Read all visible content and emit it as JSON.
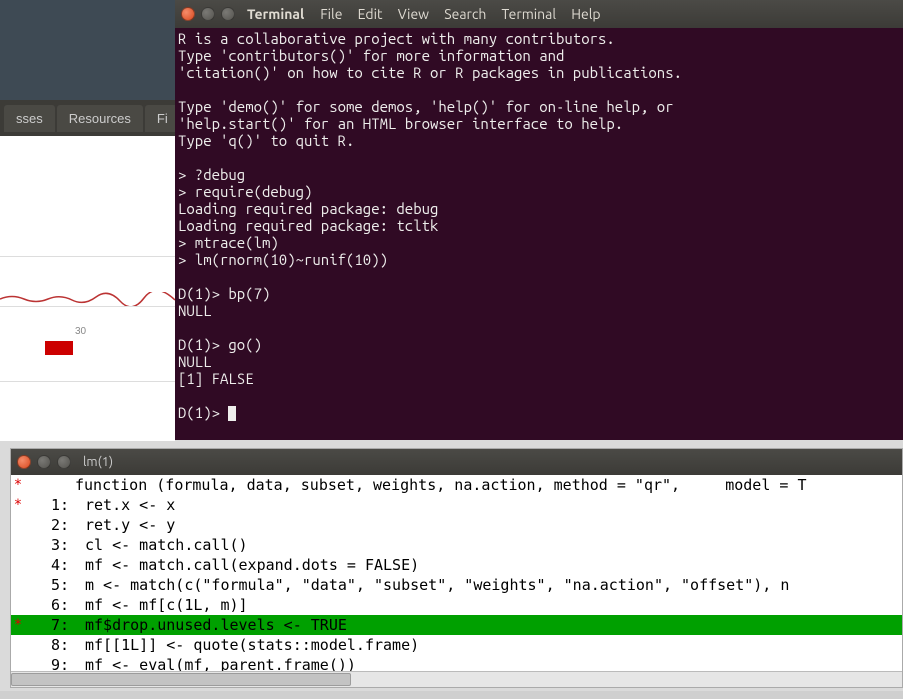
{
  "bg": {
    "tabs": [
      "sses",
      "Resources",
      "Fi"
    ],
    "axis_tick": "30"
  },
  "terminal": {
    "title": "Terminal",
    "menus": [
      "File",
      "Edit",
      "View",
      "Search",
      "Terminal",
      "Help"
    ],
    "lines": [
      "R is a collaborative project with many contributors.",
      "Type 'contributors()' for more information and",
      "'citation()' on how to cite R or R packages in publications.",
      "",
      "Type 'demo()' for some demos, 'help()' for on-line help, or",
      "'help.start()' for an HTML browser interface to help.",
      "Type 'q()' to quit R.",
      "",
      "> ?debug",
      "> require(debug)",
      "Loading required package: debug",
      "Loading required package: tcltk",
      "> mtrace(lm)",
      "> lm(rnorm(10)~runif(10))",
      "",
      "D(1)> bp(7)",
      "NULL",
      "",
      "D(1)> go()",
      "NULL",
      "[1] FALSE",
      "",
      "D(1)> "
    ]
  },
  "debug": {
    "title": "lm(1)",
    "signature": "function (formula, data, subset, weights, na.action, method = \"qr\",     model = T",
    "rows": [
      {
        "n": "1:",
        "bp": true,
        "hl": false,
        "code": "ret.x <- x"
      },
      {
        "n": "2:",
        "bp": false,
        "hl": false,
        "code": "ret.y <- y"
      },
      {
        "n": "3:",
        "bp": false,
        "hl": false,
        "code": "cl <- match.call()"
      },
      {
        "n": "4:",
        "bp": false,
        "hl": false,
        "code": "mf <- match.call(expand.dots = FALSE)"
      },
      {
        "n": "5:",
        "bp": false,
        "hl": false,
        "code": "m <- match(c(\"formula\", \"data\", \"subset\", \"weights\", \"na.action\", \"offset\"), n"
      },
      {
        "n": "6:",
        "bp": false,
        "hl": false,
        "code": "mf <- mf[c(1L, m)]"
      },
      {
        "n": "7:",
        "bp": true,
        "hl": true,
        "code": "mf$drop.unused.levels <- TRUE"
      },
      {
        "n": "8:",
        "bp": false,
        "hl": false,
        "code": "mf[[1L]] <- quote(stats::model.frame)"
      },
      {
        "n": "9:",
        "bp": false,
        "hl": false,
        "code": "mf <- eval(mf, parent.frame())"
      }
    ]
  }
}
